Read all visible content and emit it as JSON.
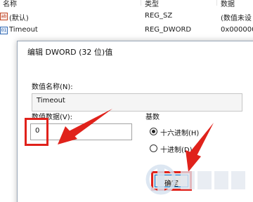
{
  "registry": {
    "columns": [
      "名称",
      "类型",
      "数据"
    ],
    "rows": [
      {
        "icon": "ab",
        "icon_name": "string-value-icon",
        "name": "(默认)",
        "type": "REG_SZ",
        "data": "(数值未设"
      },
      {
        "icon": "01",
        "icon_name": "dword-value-icon",
        "name": "Timeout",
        "type": "REG_DWORD",
        "data": "0x000000"
      }
    ]
  },
  "dialog": {
    "title": "编辑 DWORD (32 位)值",
    "value_name_label": "数值名称(N):",
    "value_name": "Timeout",
    "value_data_label": "数值数据(V):",
    "value_data": "0",
    "base_label": "基数",
    "base_options": [
      {
        "label": "十六进制(H)",
        "checked": true
      },
      {
        "label": "十进制(D)",
        "checked": false
      }
    ],
    "ok_label": "确定"
  },
  "colors": {
    "highlight_red": "#e0221b",
    "dialog_border": "#9aa7b8"
  }
}
